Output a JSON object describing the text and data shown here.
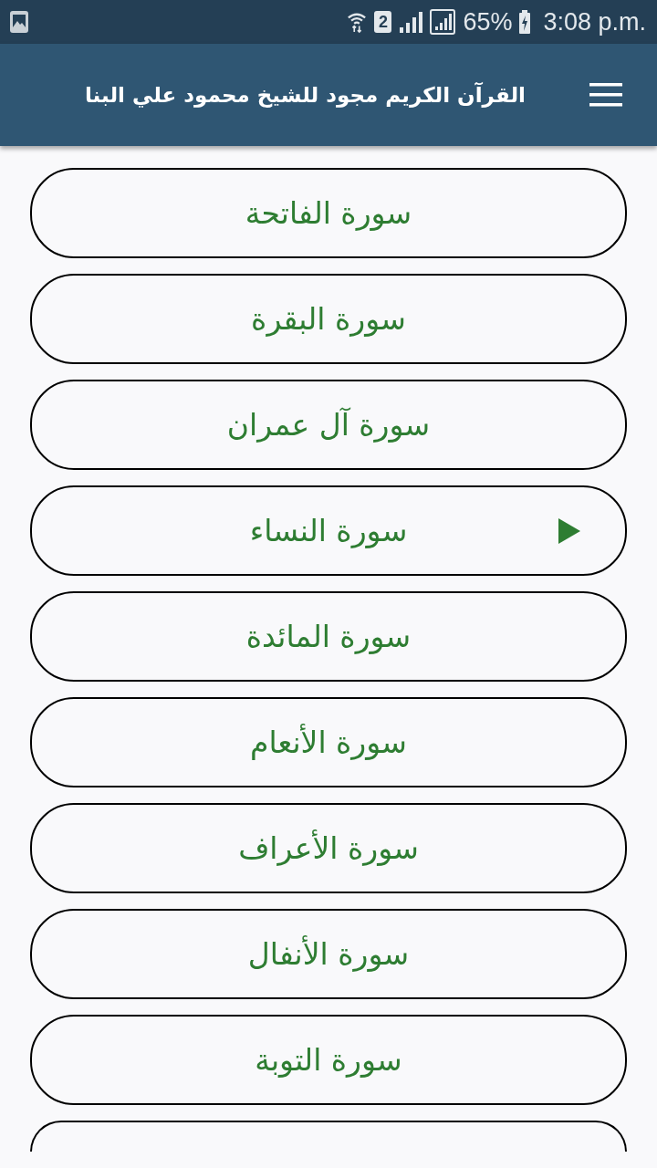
{
  "status_bar": {
    "sim_slot": "2",
    "battery": "65%",
    "time": "3:08 p.m."
  },
  "app_bar": {
    "title": "القرآن الكريم مجود للشيخ محمود علي البنا"
  },
  "surahs": [
    {
      "name": "سورة الفاتحة",
      "playing": false
    },
    {
      "name": "سورة البقرة",
      "playing": false
    },
    {
      "name": "سورة آل عمران",
      "playing": false
    },
    {
      "name": "سورة النساء",
      "playing": true
    },
    {
      "name": "سورة المائدة",
      "playing": false
    },
    {
      "name": "سورة الأنعام",
      "playing": false
    },
    {
      "name": "سورة الأعراف",
      "playing": false
    },
    {
      "name": "سورة الأنفال",
      "playing": false
    },
    {
      "name": "سورة التوبة",
      "playing": false
    }
  ]
}
